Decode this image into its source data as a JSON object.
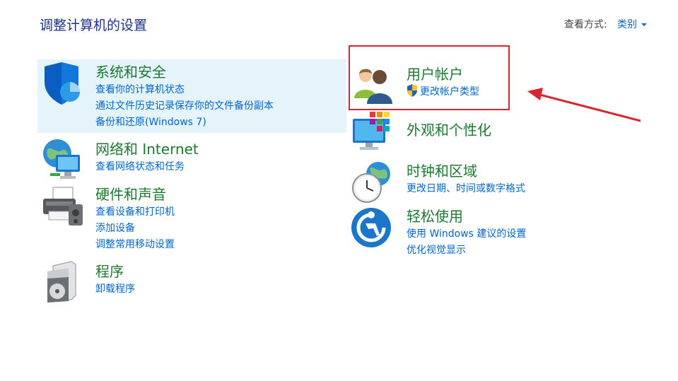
{
  "page": {
    "title": "调整计算机的设置"
  },
  "view_by": {
    "label": "查看方式:",
    "value": "类别"
  },
  "categories": [
    {
      "title": "系统和安全",
      "icon": "shield-icon",
      "links": [
        "查看你的计算机状态",
        "通过文件历史记录保存你的文件备份副本",
        "备份和还原(Windows 7)"
      ]
    },
    {
      "title": "网络和 Internet",
      "icon": "network-icon",
      "links": [
        "查看网络状态和任务"
      ]
    },
    {
      "title": "硬件和声音",
      "icon": "printer-icon",
      "links": [
        "查看设备和打印机",
        "添加设备",
        "调整常用移动设置"
      ]
    },
    {
      "title": "程序",
      "icon": "programs-icon",
      "links": [
        "卸载程序"
      ]
    },
    {
      "title": "用户帐户",
      "icon": "users-icon",
      "links": [
        "更改帐户类型"
      ]
    },
    {
      "title": "外观和个性化",
      "icon": "monitor-icon",
      "links": []
    },
    {
      "title": "时钟和区域",
      "icon": "clock-globe-icon",
      "links": [
        "更改日期、时间或数字格式"
      ]
    },
    {
      "title": "轻松使用",
      "icon": "ease-of-access-icon",
      "links": [
        "使用 Windows 建议的设置",
        "优化视觉显示"
      ]
    }
  ],
  "annotation": {
    "highlight_color": "#d9252f",
    "arrow_color": "#d9252f"
  }
}
